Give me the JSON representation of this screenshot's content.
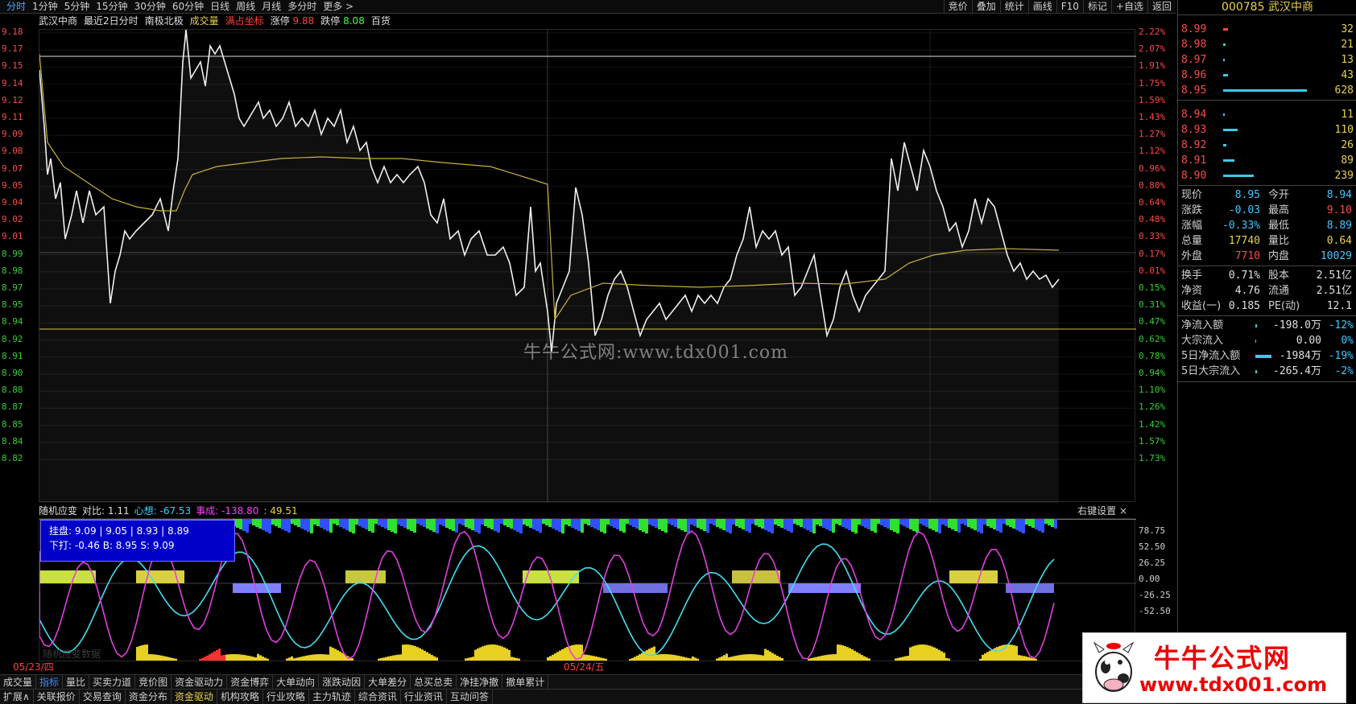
{
  "toolbar": {
    "periods": [
      "分时",
      "1分钟",
      "5分钟",
      "15分钟",
      "30分钟",
      "60分钟",
      "日线",
      "周线",
      "月线",
      "多分时",
      "更多 >"
    ],
    "active_period": 0,
    "tools": [
      "竞价",
      "叠加",
      "统计",
      "画线",
      "F10",
      "标记",
      "+自选",
      "返回"
    ]
  },
  "header": {
    "stock_name": "武汉中商",
    "mode": "最近2日分时",
    "indicator": "南极北极",
    "vol_label": "成交量",
    "coord_label": "满占坐标",
    "limit_up_label": "涨停",
    "limit_up_value": "9.88",
    "limit_down_label": "跌停",
    "limit_down_value": "8.08",
    "extra": "百货"
  },
  "left_axis": [
    "9.18",
    "9.17",
    "9.15",
    "9.14",
    "9.12",
    "9.11",
    "9.09",
    "9.08",
    "9.07",
    "9.05",
    "9.04",
    "9.02",
    "9.01",
    "8.99",
    "8.98",
    "8.97",
    "8.95",
    "8.94",
    "8.92",
    "8.91",
    "8.90",
    "8.88",
    "8.87",
    "8.85",
    "8.84",
    "8.82"
  ],
  "right_axis": [
    "2.22%",
    "2.07%",
    "1.91%",
    "1.75%",
    "1.59%",
    "1.43%",
    "1.27%",
    "1.12%",
    "0.96%",
    "0.80%",
    "0.64%",
    "0.48%",
    "0.33%",
    "0.17%",
    "0.01%",
    "0.15%",
    "0.31%",
    "0.47%",
    "0.62%",
    "0.78%",
    "0.94%",
    "1.10%",
    "1.26%",
    "1.42%",
    "1.57%",
    "1.73%"
  ],
  "watermark": "牛牛公式网:www.tdx001.com",
  "indicator_panel": {
    "name": "随机应变",
    "ratio_label": "对比:",
    "ratio_value": "1.11",
    "mind_label": "心想:",
    "mind_value": "-67.53",
    "done_label": "事成:",
    "done_value": "-138.80",
    "extra_value": ": 49.51",
    "settings": "右键设置",
    "close": "×",
    "axis": [
      "78.75",
      "52.50",
      "26.25",
      "0.00",
      "-26.25",
      "-52.50"
    ],
    "tooltip_line1": "挂盘: 9.09 | 9.05 | 8.93 | 8.89",
    "tooltip_line2": "下打: -0.46  B: 8.95  S: 9.09",
    "faint_label": "随机应变数据"
  },
  "dates": [
    "05/23/四",
    "05/24/五"
  ],
  "bottom_tabs_1": [
    "成交量",
    "指标",
    "量比",
    "买卖力道",
    "竞价图",
    "资金驱动力",
    "资金博弈",
    "大单动向",
    "涨跌动因",
    "大单差分",
    "总买总卖",
    "净挂净撤",
    "撤单累计"
  ],
  "bottom_tabs_2": [
    "扩展∧",
    "关联报价",
    "交易查询",
    "资金分布",
    "资金驱动",
    "机构攻略",
    "行业攻略",
    "主力轨迹",
    "综合资讯",
    "行业资讯",
    "互动问答"
  ],
  "right_panel": {
    "code": "000785",
    "name": "武汉中商",
    "asks": [
      {
        "price": "8.99",
        "vol": "32",
        "bar": 6,
        "red": true
      },
      {
        "price": "8.98",
        "vol": "21",
        "bar": 3
      },
      {
        "price": "8.97",
        "vol": "13",
        "bar": 2
      },
      {
        "price": "8.96",
        "vol": "43",
        "bar": 6
      },
      {
        "price": "8.95",
        "vol": "628",
        "bar": 104
      }
    ],
    "bids": [
      {
        "price": "8.94",
        "vol": "11",
        "bar": 2
      },
      {
        "price": "8.93",
        "vol": "110",
        "bar": 18
      },
      {
        "price": "8.92",
        "vol": "26",
        "bar": 4
      },
      {
        "price": "8.91",
        "vol": "89",
        "bar": 14
      },
      {
        "price": "8.90",
        "vol": "239",
        "bar": 38
      }
    ],
    "stats": [
      {
        "k1": "现价",
        "v1": "8.95",
        "c1": "#40c8ff",
        "k2": "今开",
        "v2": "8.94",
        "c2": "#40c8ff"
      },
      {
        "k1": "涨跌",
        "v1": "-0.03",
        "c1": "#40c8ff",
        "k2": "最高",
        "v2": "9.10",
        "c2": "#ff4a4a"
      },
      {
        "k1": "涨幅",
        "v1": "-0.33%",
        "c1": "#40c8ff",
        "k2": "最低",
        "v2": "8.89",
        "c2": "#40c8ff"
      },
      {
        "k1": "总量",
        "v1": "17740",
        "c1": "#e8d24a",
        "k2": "量比",
        "v2": "0.64",
        "c2": "#e8d24a"
      },
      {
        "k1": "外盘",
        "v1": "7710",
        "c1": "#ff4a4a",
        "k2": "内盘",
        "v2": "10029",
        "c2": "#40c8ff"
      }
    ],
    "stats2": [
      {
        "k1": "换手",
        "v1": "0.71%",
        "k2": "股本",
        "v2": "2.51亿"
      },
      {
        "k1": "净资",
        "v1": "4.76",
        "k2": "流通",
        "v2": "2.51亿"
      },
      {
        "k1": "收益(一)",
        "v1": "0.185",
        "k2": "PE(动)",
        "v2": "12.1"
      }
    ],
    "flows": [
      {
        "k": "净流入额",
        "v": "-198.0万",
        "p": "-12%",
        "bar": 2
      },
      {
        "k": "大宗流入",
        "v": "0.00",
        "p": "0%",
        "bar": 1
      },
      {
        "k": "5日净流入额",
        "v": "-1984万",
        "p": "-19%",
        "bar": 20
      },
      {
        "k": "5日大宗流入",
        "v": "-265.4万",
        "p": "-2%",
        "bar": 2
      }
    ]
  },
  "logo": {
    "title": "牛牛公式网",
    "url": "www.tdx001.com"
  }
}
